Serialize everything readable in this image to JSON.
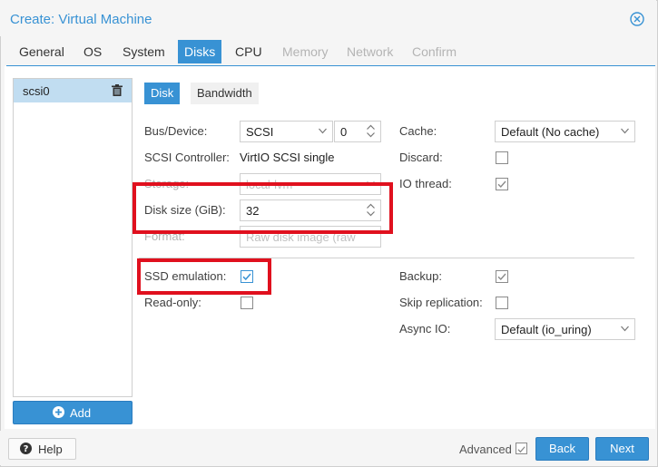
{
  "window": {
    "title": "Create: Virtual Machine"
  },
  "tabs": [
    {
      "label": "General",
      "state": "normal"
    },
    {
      "label": "OS",
      "state": "normal"
    },
    {
      "label": "System",
      "state": "normal"
    },
    {
      "label": "Disks",
      "state": "active"
    },
    {
      "label": "CPU",
      "state": "normal"
    },
    {
      "label": "Memory",
      "state": "disabled"
    },
    {
      "label": "Network",
      "state": "disabled"
    },
    {
      "label": "Confirm",
      "state": "disabled"
    }
  ],
  "disk_list": {
    "items": [
      {
        "label": "scsi0"
      }
    ],
    "add_label": "Add"
  },
  "subtabs": [
    {
      "label": "Disk"
    },
    {
      "label": "Bandwidth"
    }
  ],
  "form": {
    "bus_device": {
      "label": "Bus/Device:",
      "bus": "SCSI",
      "device": "0"
    },
    "scsi_controller": {
      "label": "SCSI Controller:",
      "value": "VirtIO SCSI single"
    },
    "storage": {
      "label": "Storage:",
      "value": "local-lvm"
    },
    "disk_size": {
      "label": "Disk size (GiB):",
      "value": "32"
    },
    "format": {
      "label": "Format:",
      "value": "Raw disk image (raw"
    },
    "cache": {
      "label": "Cache:",
      "value": "Default (No cache)"
    },
    "discard": {
      "label": "Discard:",
      "checked": false
    },
    "io_thread": {
      "label": "IO thread:",
      "checked": true
    },
    "ssd_emulation": {
      "label": "SSD emulation:",
      "checked": true
    },
    "read_only": {
      "label": "Read-only:",
      "checked": false
    },
    "backup": {
      "label": "Backup:",
      "checked": true
    },
    "skip_replication": {
      "label": "Skip replication:",
      "checked": false
    },
    "async_io": {
      "label": "Async IO:",
      "value": "Default (io_uring)"
    }
  },
  "footer": {
    "help_label": "Help",
    "advanced_label": "Advanced",
    "advanced_checked": true,
    "back_label": "Back",
    "next_label": "Next"
  },
  "colors": {
    "accent": "#3892d4",
    "highlight": "#e0101e",
    "selected_row": "#c1ddf1"
  }
}
